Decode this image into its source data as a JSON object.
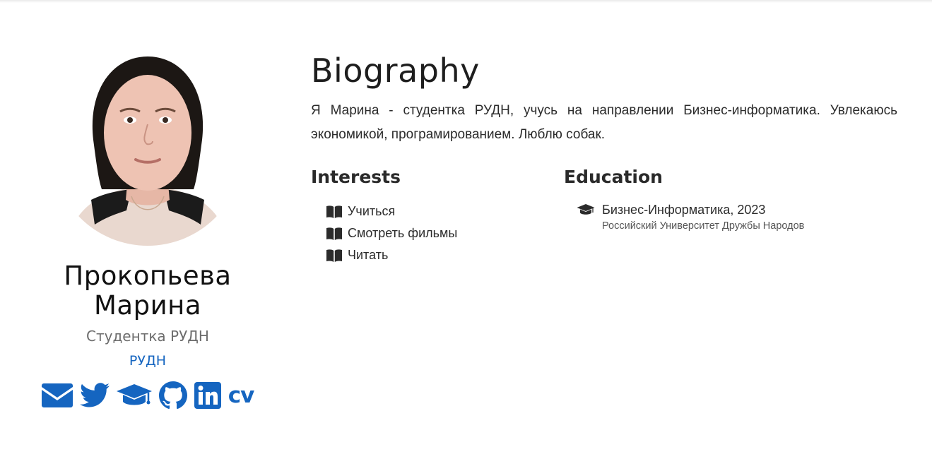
{
  "profile": {
    "avatar_alt": "avatar",
    "name_line1": "Прокопьева",
    "name_line2": "Марина",
    "role": "Студентка РУДН",
    "organization": "РУДН",
    "social_icons": [
      "envelope-icon",
      "twitter-icon",
      "graduation-cap-icon",
      "github-icon",
      "linkedin-icon",
      "cv"
    ],
    "cv_label": "cv"
  },
  "biography": {
    "title": "Biography",
    "text": "Я Марина - студентка РУДН, учусь на направлении Бизнес-информатика. Увлекаюсь экономикой, програмированием. Люблю собак."
  },
  "interests": {
    "heading": "Interests",
    "items": [
      "Учиться",
      "Смотреть фильмы",
      "Читать"
    ]
  },
  "education": {
    "heading": "Education",
    "items": [
      {
        "course": "Бизнес-Информатика, 2023",
        "institution": "Российский Университет Дружбы Народов"
      }
    ]
  },
  "colors": {
    "accent": "#1565c0",
    "text": "#2b2b2b",
    "muted": "#6c6c6c"
  }
}
